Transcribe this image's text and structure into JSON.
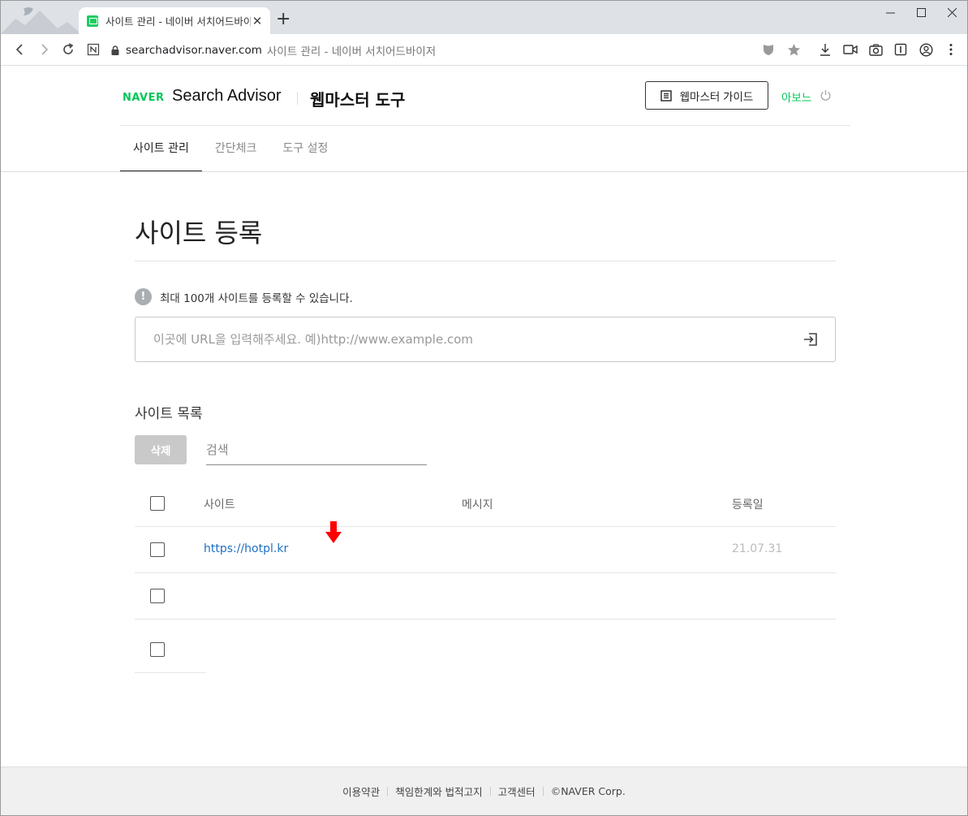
{
  "browser": {
    "tab_title": "사이트 관리 - 네이버 서치어드바이저",
    "url_host": "searchadvisor.naver.com",
    "url_title": "사이트 관리 - 네이버 서치어드바이저"
  },
  "header": {
    "brand": "NAVER",
    "product": "Search Advisor",
    "section": "웹마스터 도구",
    "guide_label": "웹마스터 가이드",
    "user_name": "아보느"
  },
  "nav": {
    "tabs": [
      {
        "label": "사이트 관리",
        "active": true
      },
      {
        "label": "간단체크",
        "active": false
      },
      {
        "label": "도구 설정",
        "active": false
      }
    ]
  },
  "main": {
    "title": "사이트 등록",
    "notice": "최대 100개 사이트를 등록할 수 있습니다.",
    "url_input_placeholder": "이곳에 URL을 입력해주세요. 예)http://www.example.com",
    "url_input_value": ""
  },
  "site_list": {
    "title": "사이트 목록",
    "delete_label": "삭제",
    "search_placeholder": "검색",
    "columns": {
      "site": "사이트",
      "message": "메시지",
      "date": "등록일"
    },
    "rows": [
      {
        "site": "https://hotpl.kr",
        "message": "",
        "date": "21.07.31"
      },
      {
        "site": "",
        "message": "",
        "date": ""
      }
    ]
  },
  "footer": {
    "links": [
      "이용약관",
      "책임한계와 법적고지",
      "고객센터"
    ],
    "copyright": "©NAVER Corp."
  },
  "colors": {
    "brand_green": "#03c75a",
    "link_blue": "#1f6fc5",
    "arrow_red": "#ff0000"
  }
}
